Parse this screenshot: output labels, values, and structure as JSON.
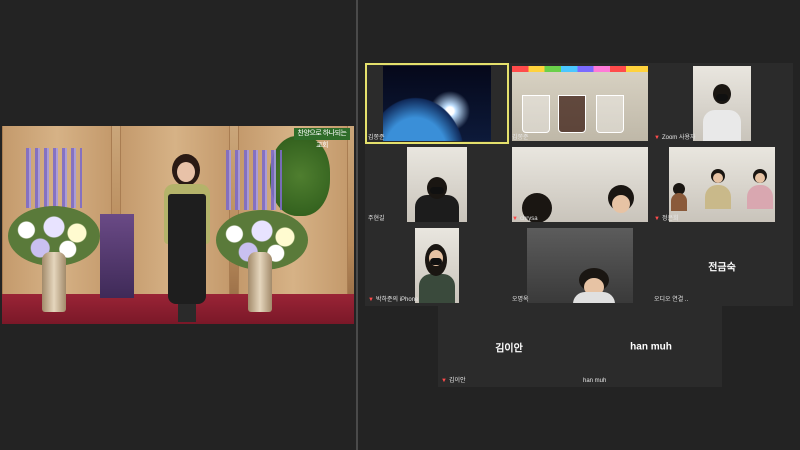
{
  "share": {
    "banner_text": "찬양으로 하나되는 교회"
  },
  "gallery": [
    {
      "name": "김쫑준",
      "muted": false,
      "active": true
    },
    {
      "name": "김쫑준",
      "muted": false,
      "active": false
    },
    {
      "name": "Zoom 사용자",
      "muted": true,
      "active": false
    },
    {
      "name": "주현길",
      "muted": false,
      "active": false
    },
    {
      "name": "chrysa",
      "muted": true,
      "active": false
    },
    {
      "name": "정은희",
      "muted": true,
      "active": false
    },
    {
      "name": "박하준의 iPhone",
      "muted": true,
      "active": false
    },
    {
      "name": "오명옥",
      "muted": false,
      "active": false
    },
    {
      "name": "오디오 연결 ..",
      "muted": false,
      "active": false,
      "center_name": "전금숙"
    },
    {
      "name": "김이안",
      "muted": true,
      "active": false,
      "center_name": "김이안"
    },
    {
      "name": "han muh",
      "muted": false,
      "active": false,
      "center_name": "han muh"
    }
  ],
  "colors": {
    "background": "#232323",
    "tile": "#2b2b2b",
    "active_speaker": "#e4e06c",
    "muted_icon": "#ff4b4b"
  },
  "icons": {
    "muted": "mic-off-icon"
  }
}
